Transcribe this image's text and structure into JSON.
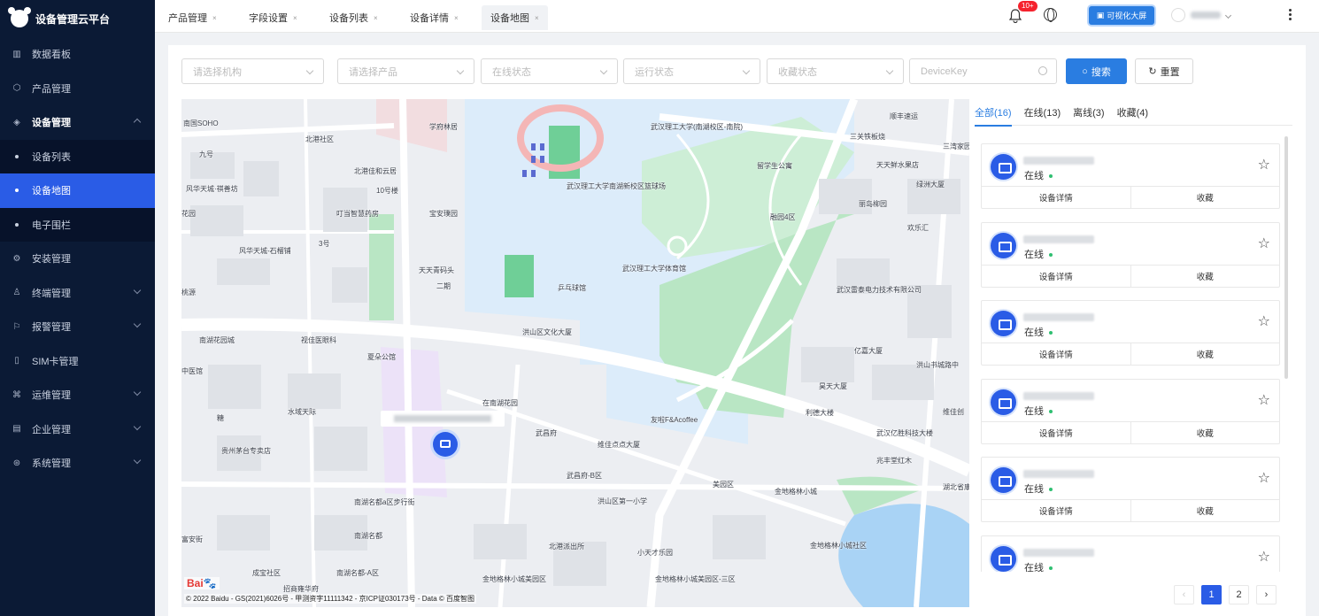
{
  "app": {
    "title": "设备管理云平台"
  },
  "sidebar": {
    "items": [
      {
        "label": "数据看板",
        "icon": "bar-chart-icon",
        "type": "top"
      },
      {
        "label": "产品管理",
        "icon": "cube-icon",
        "type": "top"
      },
      {
        "label": "设备管理",
        "icon": "layers-icon",
        "type": "open"
      },
      {
        "label": "设备列表",
        "type": "sub"
      },
      {
        "label": "设备地图",
        "type": "sub-active"
      },
      {
        "label": "电子围栏",
        "type": "sub"
      },
      {
        "label": "安装管理",
        "icon": "wrench-icon",
        "type": "top"
      },
      {
        "label": "终端管理",
        "icon": "user-icon",
        "type": "expand"
      },
      {
        "label": "报警管理",
        "icon": "alarm-icon",
        "type": "expand"
      },
      {
        "label": "SIM卡管理",
        "icon": "sim-card-icon",
        "type": "top"
      },
      {
        "label": "运维管理",
        "icon": "ops-icon",
        "type": "expand"
      },
      {
        "label": "企业管理",
        "icon": "building-icon",
        "type": "expand"
      },
      {
        "label": "系统管理",
        "icon": "settings-icon",
        "type": "expand"
      }
    ]
  },
  "tabs": [
    {
      "label": "产品管理",
      "close": "×"
    },
    {
      "label": "字段设置",
      "close": "×"
    },
    {
      "label": "设备列表",
      "close": "×"
    },
    {
      "label": "设备详情",
      "close": "×"
    },
    {
      "label": "设备地图",
      "close": "×"
    }
  ],
  "header": {
    "badge": "10+",
    "viz_button": "可视化大屏"
  },
  "filters": {
    "org": "请选择机构",
    "product": "请选择产品",
    "online": "在线状态",
    "run": "运行状态",
    "fav": "收藏状态",
    "devicekey": "DeviceKey",
    "search": "搜索",
    "reset": "重置"
  },
  "map": {
    "copyright": "© 2022 Baidu - GS(2021)6026号 - 甲测资字11111342 - 京ICP证030173号 - Data © 百度智图",
    "logo": "Bai",
    "labels": [
      {
        "t": "南国SOHO"
      },
      {
        "t": "北港社区"
      },
      {
        "t": "学府林居"
      },
      {
        "t": "九号"
      },
      {
        "t": "北港佳和云居"
      },
      {
        "t": "风华天城·祺善坊"
      },
      {
        "t": "10号楼"
      },
      {
        "t": "花园"
      },
      {
        "t": "叮当智慧药房"
      },
      {
        "t": "宝安璞园"
      },
      {
        "t": "风华天城-石榴铺"
      },
      {
        "t": "3号"
      },
      {
        "t": "天天青码头"
      },
      {
        "t": "二期"
      },
      {
        "t": "桃源"
      },
      {
        "t": "南湖花园城"
      },
      {
        "t": "视佳医眼科"
      },
      {
        "t": "夏朵公馆"
      },
      {
        "t": "中医馆"
      },
      {
        "t": "水域天际"
      },
      {
        "t": "糖"
      },
      {
        "t": "贵州茅台专卖店"
      },
      {
        "t": "南湖名都a区步行街"
      },
      {
        "t": "南湖名都"
      },
      {
        "t": "南湖名都-A区"
      },
      {
        "t": "成宝社区"
      },
      {
        "t": "招商雍华府"
      },
      {
        "t": "富安街"
      },
      {
        "t": "武汉理工大学(南湖校区-南院)"
      },
      {
        "t": "武汉理工大学南湖新校区篮球场"
      },
      {
        "t": "乒乓球馆"
      },
      {
        "t": "武汉理工大学体育馆"
      },
      {
        "t": "洪山区文化大厦"
      },
      {
        "t": "留学生公寓"
      },
      {
        "t": "三关铁板烧"
      },
      {
        "t": "顺丰速运"
      },
      {
        "t": "天天鲜水果店"
      },
      {
        "t": "绿洲大厦"
      },
      {
        "t": "丽岛柳园"
      },
      {
        "t": "欢乐汇"
      },
      {
        "t": "武汉雷泰电力技术有限公司"
      },
      {
        "t": "亿嘉大厦"
      },
      {
        "t": "洪山书城路中"
      },
      {
        "t": "昊天大厦"
      },
      {
        "t": "利德大楼"
      },
      {
        "t": "维佳创"
      },
      {
        "t": "武汉亿胜科技大楼"
      },
      {
        "t": "兆丰堂红木"
      },
      {
        "t": "在南湖花园"
      },
      {
        "t": "友啦F&Acoffee"
      },
      {
        "t": "武昌府"
      },
      {
        "t": "维佳点点大厦"
      },
      {
        "t": "武昌府-B区"
      },
      {
        "t": "洪山区第一小学"
      },
      {
        "t": "美园区"
      },
      {
        "t": "金地格林小城"
      },
      {
        "t": "北港派出所"
      },
      {
        "t": "小天才乐园"
      },
      {
        "t": "金地格林小城美园区-三区"
      },
      {
        "t": "金地格林小城社区"
      },
      {
        "t": "金地格林小城美园区"
      },
      {
        "t": "湖北省康"
      },
      {
        "t": "三湾家园"
      },
      {
        "t": "融园4区"
      }
    ]
  },
  "panel": {
    "tabs": [
      "全部(16)",
      "在线(13)",
      "离线(3)",
      "收藏(4)"
    ],
    "cards": [
      {
        "status": "在线",
        "detail": "设备详情",
        "fav": "收藏"
      },
      {
        "status": "在线",
        "detail": "设备详情",
        "fav": "收藏"
      },
      {
        "status": "在线",
        "detail": "设备详情",
        "fav": "收藏"
      },
      {
        "status": "在线",
        "detail": "设备详情",
        "fav": "收藏"
      },
      {
        "status": "在线",
        "detail": "设备详情",
        "fav": "收藏"
      },
      {
        "status": "在线",
        "detail": "设备详情",
        "fav": "收藏"
      }
    ],
    "pager": {
      "prev": "‹",
      "pages": [
        "1",
        "2"
      ],
      "next": "›",
      "current": "1"
    }
  },
  "colors": {
    "sidebar": "#0b1a35",
    "accent": "#2a5ce6",
    "primary": "#2a7de1",
    "online": "#2fbf71"
  }
}
